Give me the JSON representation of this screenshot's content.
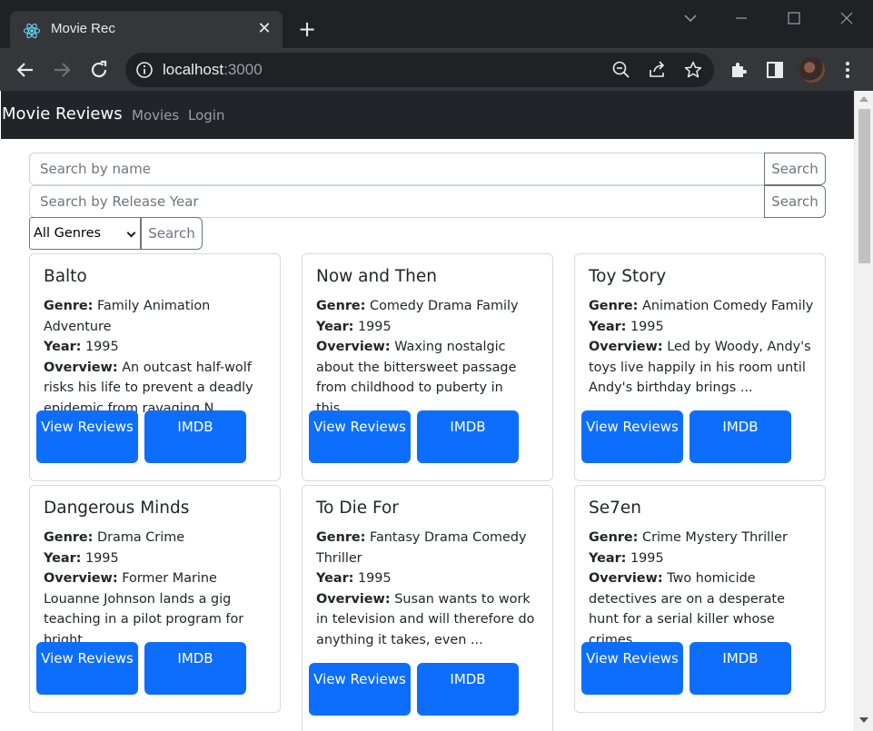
{
  "browser": {
    "tab_title": "Movie Rec",
    "url_host": "localhost",
    "url_port": ":3000"
  },
  "navbar": {
    "brand": "Movie Reviews",
    "links": [
      "Movies",
      "Login"
    ]
  },
  "search": {
    "name_placeholder": "Search by name",
    "year_placeholder": "Search by Release Year",
    "button_label": "Search",
    "genre_selected": "All Genres"
  },
  "labels": {
    "genre": "Genre:",
    "year": "Year:",
    "overview": "Overview:",
    "view_reviews": "View Reviews",
    "imdb": "IMDB"
  },
  "movies": [
    {
      "title": "Balto",
      "genre": "Family Animation Adventure",
      "year": "1995",
      "overview": "An outcast half-wolf risks his life to prevent a deadly epidemic from ravaging N..."
    },
    {
      "title": "Now and Then",
      "genre": "Comedy Drama Family",
      "year": "1995",
      "overview": "Waxing nostalgic about the bittersweet passage from childhood to puberty in this..."
    },
    {
      "title": "Toy Story",
      "genre": "Animation Comedy Family",
      "year": "1995",
      "overview": "Led by Woody, Andy's toys live happily in his room until Andy's birthday brings ..."
    },
    {
      "title": "Dangerous Minds",
      "genre": "Drama Crime",
      "year": "1995",
      "overview": "Former Marine Louanne Johnson lands a gig teaching in a pilot program for bright..."
    },
    {
      "title": "To Die For",
      "genre": "Fantasy Drama Comedy Thriller",
      "year": "1995",
      "overview": "Susan wants to work in television and will therefore do anything it takes, even ..."
    },
    {
      "title": "Se7en",
      "genre": "Crime Mystery Thriller",
      "year": "1995",
      "overview": "Two homicide detectives are on a desperate hunt for a serial killer whose crimes..."
    }
  ]
}
